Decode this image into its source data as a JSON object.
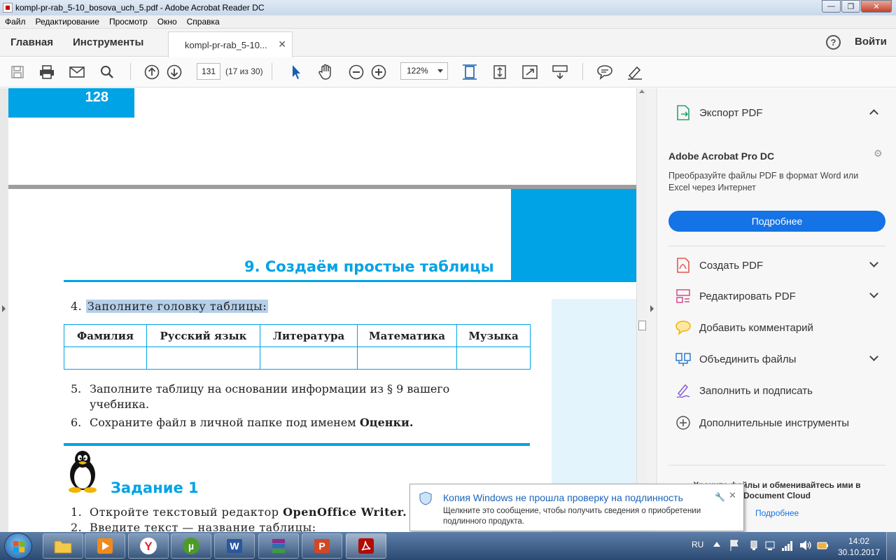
{
  "window": {
    "title": "kompl-pr-rab_5-10_bosova_uch_5.pdf - Adobe Acrobat Reader DC"
  },
  "menu": [
    "Файл",
    "Редактирование",
    "Просмотр",
    "Окно",
    "Справка"
  ],
  "tabs": {
    "home": "Главная",
    "tools": "Инструменты",
    "document": "kompl-pr-rab_5-10...",
    "signin": "Войти"
  },
  "toolbar": {
    "page_number": "131",
    "page_count": "(17 из 30)",
    "zoom": "122%"
  },
  "document": {
    "page_label": "128",
    "section_title": "9. Создаём простые таблицы",
    "task4": {
      "num": "4.",
      "text": "Заполните головку таблицы:"
    },
    "table_headers": [
      "Фамилия",
      "Русский язык",
      "Литература",
      "Математика",
      "Музыка"
    ],
    "task5": {
      "num": "5.",
      "text": "Заполните таблицу на основании информации из § 9 вашего",
      "text_cont": "учебника."
    },
    "task6": {
      "num": "6.",
      "text": "Сохраните файл в личной папке под именем ",
      "bold": "Оценки."
    },
    "zadanie": "Задание 1",
    "z1": {
      "num": "1.",
      "text": "Откройте текстовый редактор ",
      "bold": "OpenOffice Writer."
    },
    "z2": {
      "num": "2.",
      "text": "Введите текст — название таблицы:"
    }
  },
  "panel": {
    "export_pdf": "Экспорт PDF",
    "promo_title": "Adobe Acrobat Pro DC",
    "promo_text": "Преобразуйте файлы PDF в формат Word или Excel через Интернет",
    "promo_button": "Подробнее",
    "items": [
      {
        "label": "Создать PDF",
        "has_chevron": true
      },
      {
        "label": "Редактировать PDF",
        "has_chevron": true
      },
      {
        "label": "Добавить комментарий",
        "has_chevron": false
      },
      {
        "label": "Объединить файлы",
        "has_chevron": true
      },
      {
        "label": "Заполнить и подписать",
        "has_chevron": false
      },
      {
        "label": "Дополнительные инструменты",
        "has_chevron": false
      }
    ],
    "cloud_text": "Храните файлы и обменивайтесь ими в Document Cloud",
    "cloud_link": "Подробнее"
  },
  "toast": {
    "title": "Копия Windows не прошла проверку на подлинность",
    "text": "Щелкните это сообщение, чтобы получить сведения о приобретении подлинного продукта."
  },
  "taskbar": {
    "lang": "RU",
    "time": "14:02",
    "date": "30.10.2017"
  },
  "colors": {
    "accent_blue": "#00a3e6",
    "button_blue": "#1473e6",
    "highlight": "#b5cfe8"
  }
}
